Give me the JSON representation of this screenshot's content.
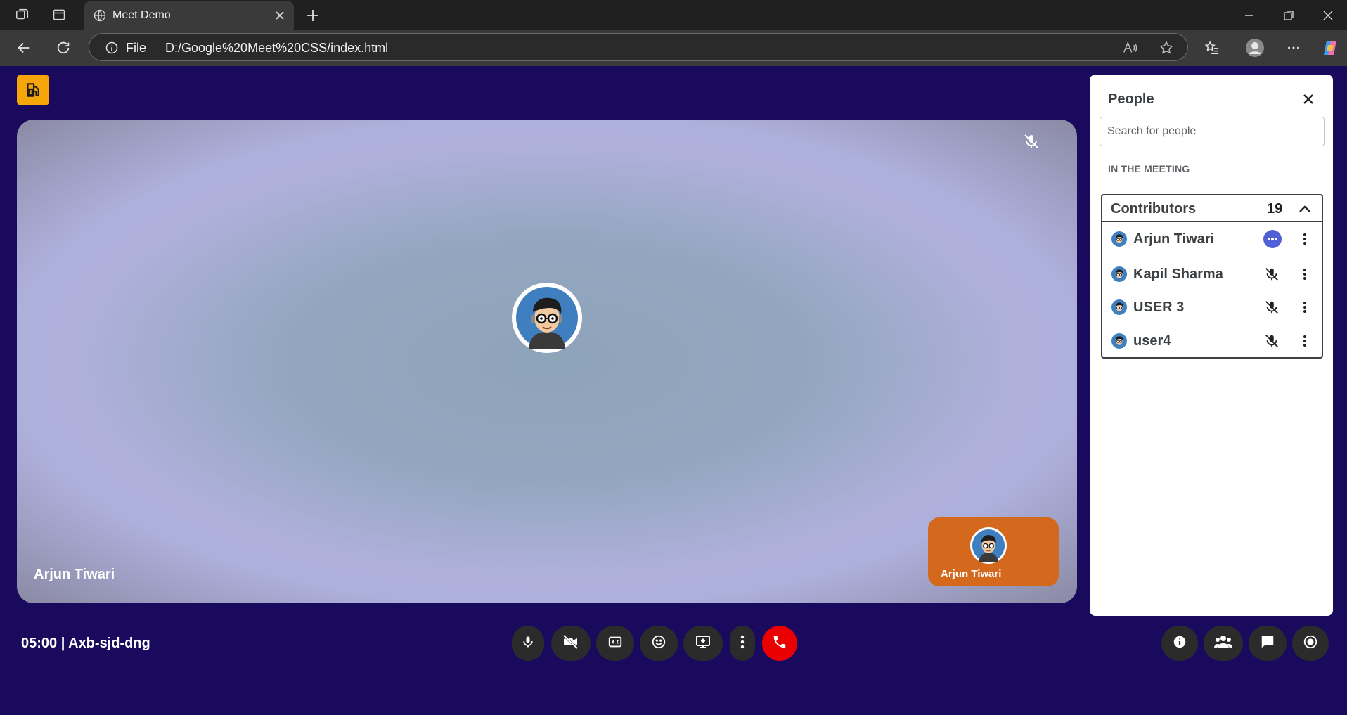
{
  "browser": {
    "tab_title": "Meet Demo",
    "address_scheme": "File",
    "address_url": "D:/Google%20Meet%20CSS/index.html",
    "icons": [
      "workspaces-icon",
      "tab-actions-icon",
      "globe-icon",
      "close-icon",
      "plus-icon",
      "minimize-icon",
      "restore-icon",
      "back-icon",
      "refresh-icon",
      "info-icon",
      "read-aloud-icon",
      "favorite-icon",
      "favorites-icon",
      "profile-icon",
      "more-icon",
      "copilot-icon"
    ]
  },
  "app": {
    "logo_icon": "fuel-pump-icon",
    "brand_color": "#f6a609",
    "background_color": "#1a0a5e",
    "stage": {
      "participant_name": "Arjun Tiwari",
      "muted": true
    },
    "self_tile": {
      "name": "Arjun Tiwari",
      "color": "#d4691e"
    },
    "meeting_info": "05:00 | Axb-sjd-dng",
    "controls": [
      {
        "name": "mic",
        "icon": "microphone-icon"
      },
      {
        "name": "camera",
        "icon": "video-off-icon"
      },
      {
        "name": "captions",
        "icon": "closed-captions-icon"
      },
      {
        "name": "reactions",
        "icon": "emoji-icon"
      },
      {
        "name": "present",
        "icon": "present-screen-icon"
      },
      {
        "name": "more",
        "icon": "more-vertical-icon"
      },
      {
        "name": "leave-call",
        "icon": "phone-end-icon",
        "color": "#ea0000"
      }
    ],
    "side_controls": [
      {
        "name": "meeting-details",
        "icon": "info-icon"
      },
      {
        "name": "people",
        "icon": "people-icon"
      },
      {
        "name": "chat",
        "icon": "chat-icon"
      },
      {
        "name": "activities",
        "icon": "activities-icon"
      }
    ]
  },
  "people_panel": {
    "title": "People",
    "search_placeholder": "Search for people",
    "section_label": "IN THE MEETING",
    "group": {
      "name": "Contributors",
      "count": "19",
      "members": [
        {
          "name": "Arjun Tiwari",
          "status": "speaking"
        },
        {
          "name": "Kapil Sharma",
          "status": "muted"
        },
        {
          "name": "USER 3",
          "status": "muted"
        },
        {
          "name": "user4",
          "status": "muted"
        }
      ]
    }
  }
}
